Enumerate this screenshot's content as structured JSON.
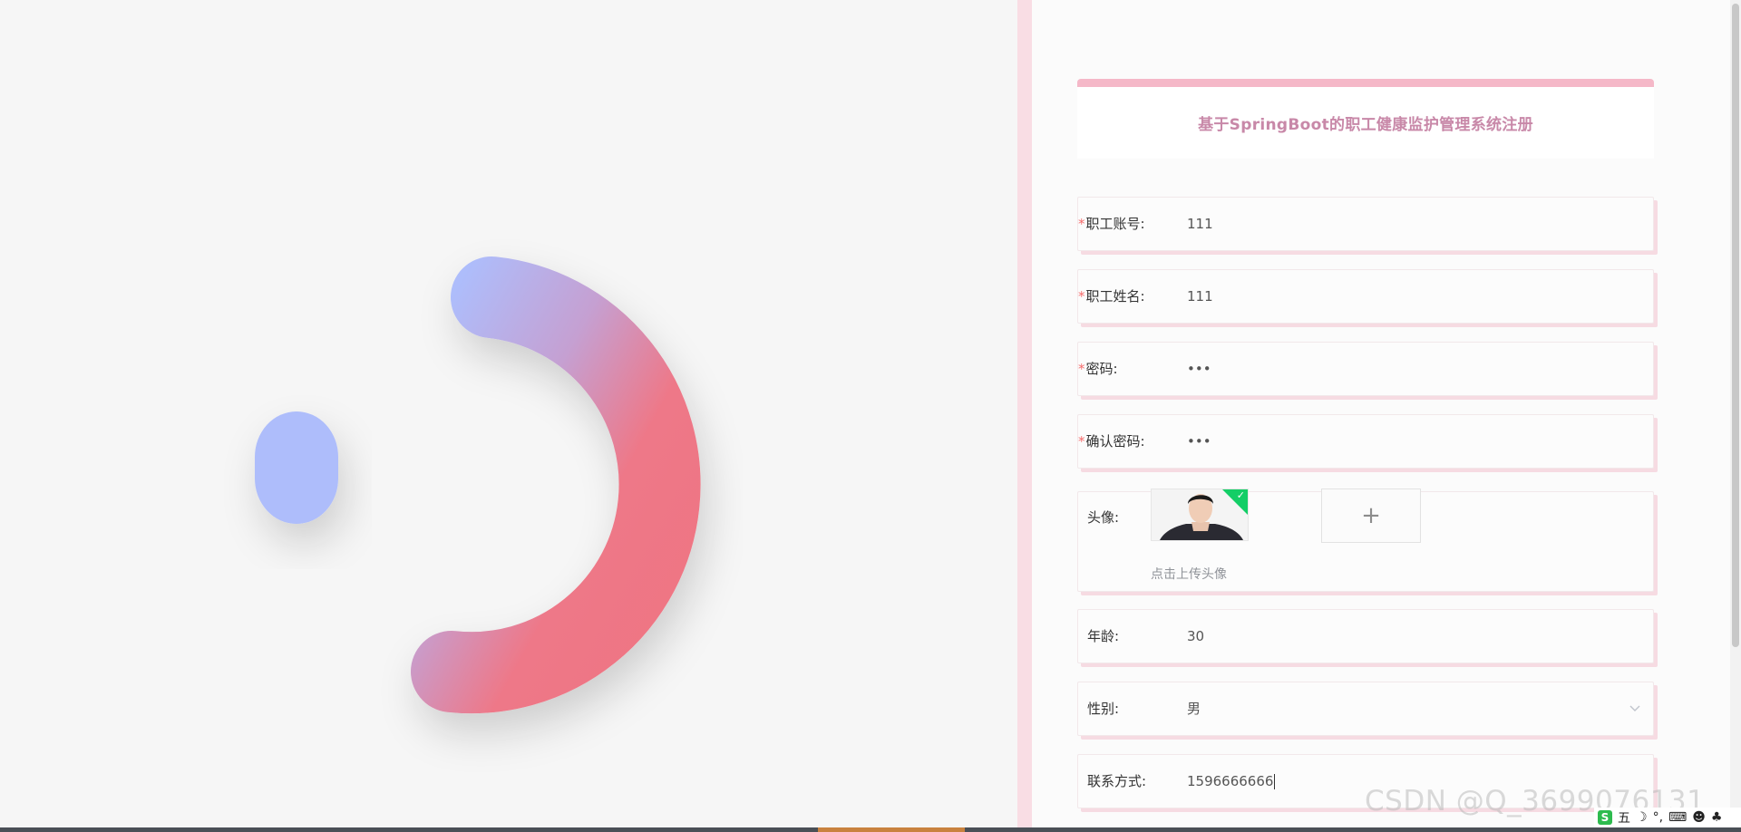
{
  "form": {
    "title": "基于SpringBoot的职工健康监护管理系统注册",
    "account": {
      "label": "职工账号:",
      "value": "111",
      "required": "*"
    },
    "name": {
      "label": "职工姓名:",
      "value": "111",
      "required": "*"
    },
    "password": {
      "label": "密码:",
      "value": "•••",
      "required": "*"
    },
    "confirm": {
      "label": "确认密码:",
      "value": "•••",
      "required": "*"
    },
    "avatar": {
      "label": "头像:",
      "upload_plus": "+",
      "upload_tip": "点击上传头像",
      "success_check": "✓"
    },
    "age": {
      "label": "年龄:",
      "value": "30"
    },
    "gender": {
      "label": "性别:",
      "value": "男",
      "icon": "chevron-down-icon"
    },
    "contact": {
      "label": "联系方式:",
      "value": "1596666666"
    }
  },
  "watermark": "CSDN @Q_3699076131",
  "ime": {
    "logo": "S",
    "mode": "五",
    "icons": [
      "moon-icon",
      "comma-icon",
      "keyboard-icon",
      "person-icon",
      "clover-icon"
    ]
  },
  "colors": {
    "title_accent": "#f5b8c8",
    "title_text": "#c888a8",
    "required": "#f56c6c",
    "field_shadow": "#f6dbe2",
    "ring_gradient": [
      "#aebdfb",
      "#c59fd0",
      "#ee7888",
      "#ef7583"
    ]
  }
}
